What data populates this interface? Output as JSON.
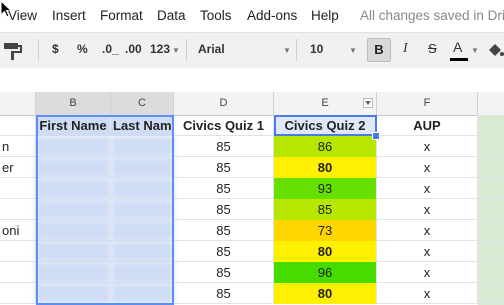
{
  "menu": {
    "items": [
      "View",
      "Insert",
      "Format",
      "Data",
      "Tools",
      "Add-ons",
      "Help"
    ],
    "status": "All changes saved in Driv"
  },
  "toolbar": {
    "currency": "$",
    "percent": "%",
    "decrease_decimal": ".0_",
    "increase_decimal": ".00",
    "more_formats": "123",
    "font": "Arial",
    "font_size": "10",
    "bold": "B",
    "italic": "I",
    "strike": "S",
    "text_color": "A"
  },
  "columns": [
    "B",
    "C",
    "D",
    "E",
    "F"
  ],
  "headers": {
    "b": "First Name",
    "c": "Last Nam",
    "d": "Civics Quiz 1",
    "e": "Civics Quiz 2",
    "f": "AUP"
  },
  "rows": [
    {
      "a": "n",
      "d": "85",
      "e": "86",
      "e_bold": false,
      "f": "x",
      "color": "#b7e600"
    },
    {
      "a": "er",
      "d": "85",
      "e": "80",
      "e_bold": true,
      "f": "x",
      "color": "#ffef00"
    },
    {
      "a": "",
      "d": "85",
      "e": "93",
      "e_bold": false,
      "f": "x",
      "color": "#66e000"
    },
    {
      "a": "",
      "d": "85",
      "e": "85",
      "e_bold": false,
      "f": "x",
      "color": "#b7e600"
    },
    {
      "a": "oni",
      "d": "85",
      "e": "73",
      "e_bold": false,
      "f": "x",
      "color": "#ffd500"
    },
    {
      "a": "",
      "d": "85",
      "e": "80",
      "e_bold": true,
      "f": "x",
      "color": "#ffef00"
    },
    {
      "a": "",
      "d": "85",
      "e": "96",
      "e_bold": false,
      "f": "x",
      "color": "#46dc00"
    },
    {
      "a": "",
      "d": "85",
      "e": "80",
      "e_bold": true,
      "f": "x",
      "color": "#ffef00"
    }
  ],
  "colors": {
    "selection": "#4a7be8",
    "toolbar_bg": "#f1f1f1",
    "aup_column_fill": "#d9ead3"
  }
}
